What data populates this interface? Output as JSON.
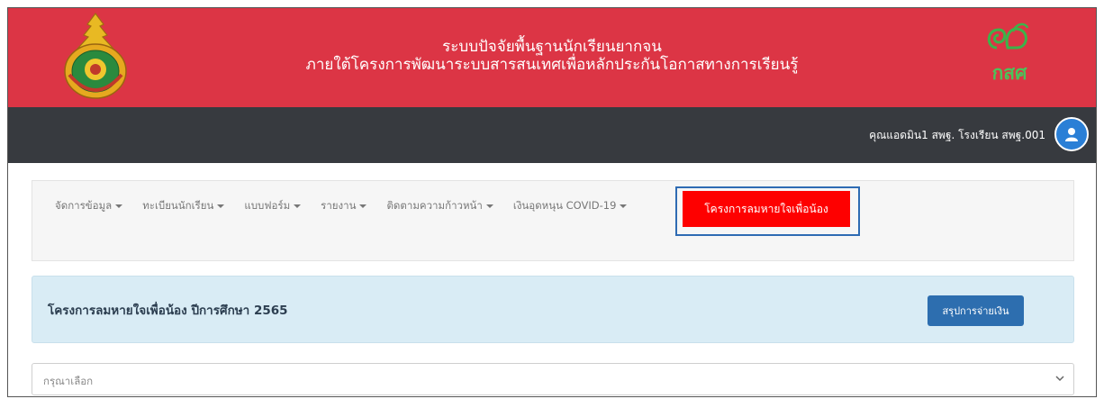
{
  "header": {
    "title_line1": "ระบบปัจจัยพื้นฐานนักเรียนยากจน",
    "title_line2": "ภายใต้โครงการพัฒนาระบบสารสนเทศเพื่อหลักประกันโอกาสทางการเรียนรู้",
    "brand_text": "กสศ",
    "banner_color": "#dc3545"
  },
  "userbar": {
    "user_label": "คุณแอดมิน1 สพฐ. โรงเรียน สพฐ.001",
    "avatar_icon": "user-icon"
  },
  "nav": {
    "items": [
      {
        "label": "จัดการข้อมูล"
      },
      {
        "label": "ทะเบียนนักเรียน"
      },
      {
        "label": "แบบฟอร์ม"
      },
      {
        "label": "รายงาน"
      },
      {
        "label": "ติดตามความก้าวหน้า"
      },
      {
        "label": "เงินอุดหนุน COVID-19"
      }
    ],
    "active_label": "โครงการลมหายใจเพื่อน้อง",
    "active_color": "#fe0000",
    "highlight_color": "#2e6bb3"
  },
  "panel": {
    "title": "โครงการลมหายใจเพื่อน้อง ปีการศึกษา 2565",
    "button_label": "สรุปการจ่ายเงิน"
  },
  "select": {
    "value": "กรุณาเลือก"
  }
}
